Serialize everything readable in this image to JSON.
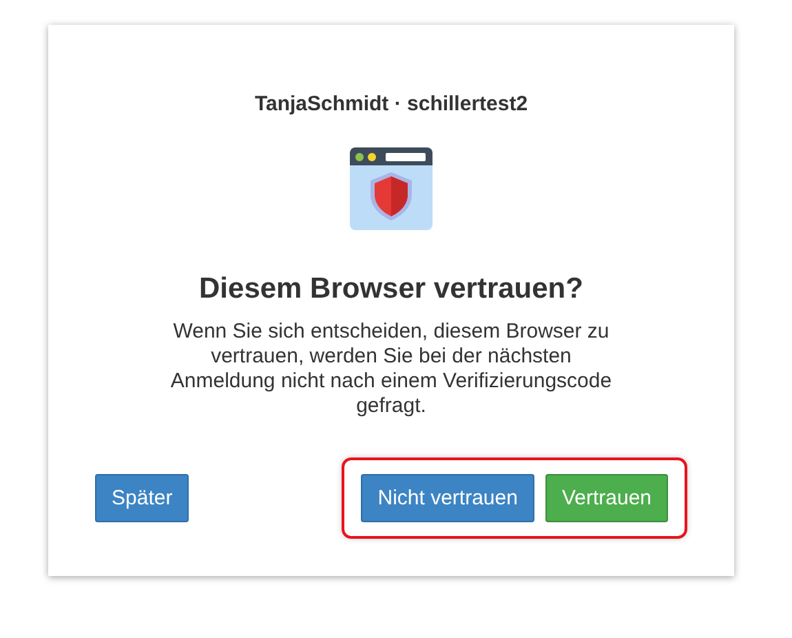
{
  "account": "TanjaSchmidt · schillertest2",
  "heading": "Diesem Browser vertrauen?",
  "message": "Wenn Sie sich entscheiden, diesem Browser zu vertrauen, werden Sie bei der nächsten Anmeldung nicht nach einem Verifizierungscode gefragt.",
  "later_button": {
    "label": "Später",
    "kind": "primary"
  },
  "highlighted_buttons": [
    {
      "label": "Nicht vertrauen",
      "kind": "primary"
    },
    {
      "label": "Vertrauen",
      "kind": "success"
    }
  ]
}
